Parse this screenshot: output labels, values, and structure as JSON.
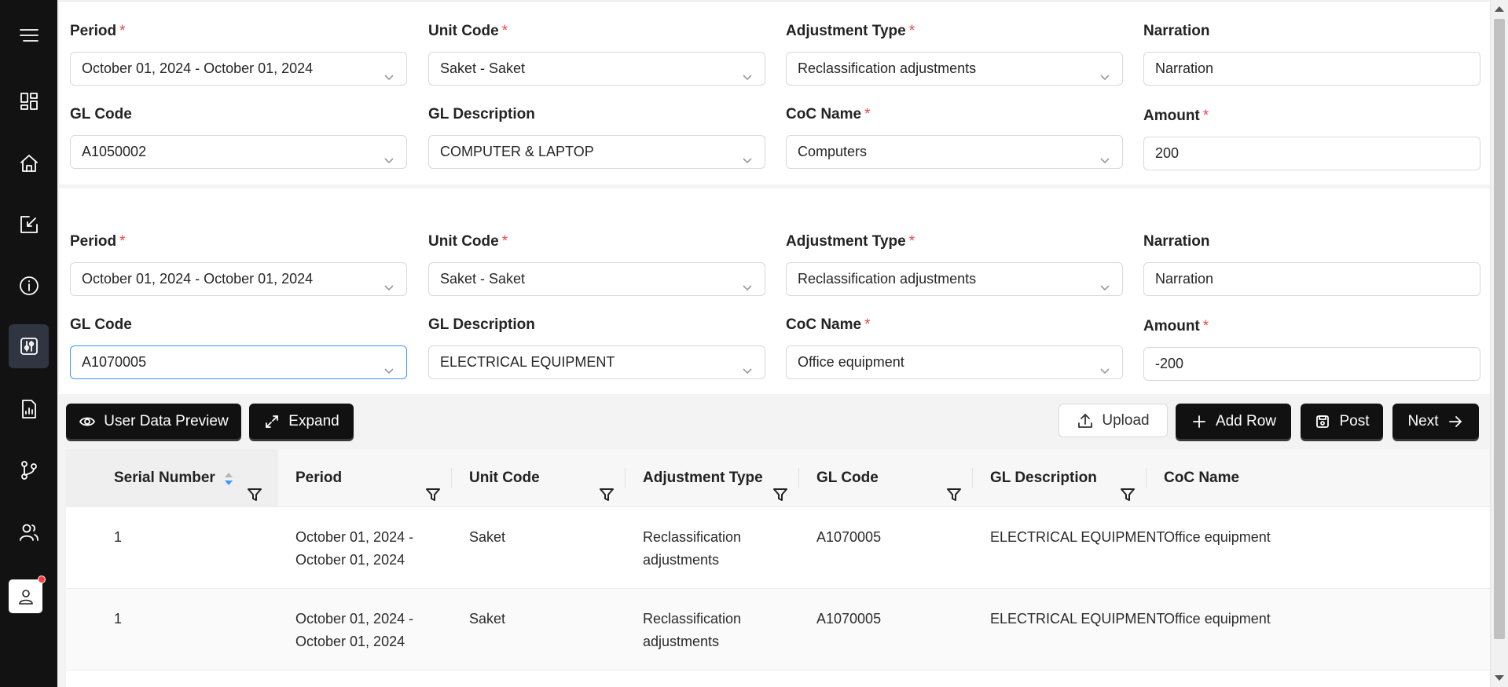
{
  "sidebar": {
    "items": [
      {
        "icon": "menu-icon"
      },
      {
        "icon": "dashboard-icon"
      },
      {
        "icon": "home-icon"
      },
      {
        "icon": "edit-square-icon"
      },
      {
        "icon": "info-icon"
      },
      {
        "icon": "adjustments-icon",
        "active": true
      },
      {
        "icon": "report-icon"
      },
      {
        "icon": "branch-icon"
      },
      {
        "icon": "users-icon"
      }
    ],
    "user_icon": "user-icon"
  },
  "entry1": {
    "period": {
      "label": "Period",
      "required": "*",
      "value": "October 01, 2024 - October 01, 2024"
    },
    "unit_code": {
      "label": "Unit Code",
      "required": "*",
      "value": "Saket - Saket"
    },
    "adjustment_type": {
      "label": "Adjustment Type",
      "required": "*",
      "value": "Reclassification adjustments"
    },
    "narration": {
      "label": "Narration",
      "value": "Narration"
    },
    "gl_code": {
      "label": "GL Code",
      "value": "A1050002"
    },
    "gl_description": {
      "label": "GL Description",
      "value": "COMPUTER & LAPTOP"
    },
    "coc_name": {
      "label": "CoC Name",
      "required": "*",
      "value": "Computers"
    },
    "amount": {
      "label": "Amount",
      "required": "*",
      "value": "200"
    }
  },
  "entry2": {
    "period": {
      "label": "Period",
      "required": "*",
      "value": "October 01, 2024 - October 01, 2024"
    },
    "unit_code": {
      "label": "Unit Code",
      "required": "*",
      "value": "Saket - Saket"
    },
    "adjustment_type": {
      "label": "Adjustment Type",
      "required": "*",
      "value": "Reclassification adjustments"
    },
    "narration": {
      "label": "Narration",
      "value": "Narration"
    },
    "gl_code": {
      "label": "GL Code",
      "value": "A1070005"
    },
    "gl_description": {
      "label": "GL Description",
      "value": "ELECTRICAL EQUIPMENT"
    },
    "coc_name": {
      "label": "CoC Name",
      "required": "*",
      "value": "Office equipment"
    },
    "amount": {
      "label": "Amount",
      "required": "*",
      "value": "-200"
    }
  },
  "toolbar": {
    "user_data_preview": "User Data Preview",
    "expand": "Expand",
    "upload": "Upload",
    "add_row": "Add Row",
    "post": "Post",
    "next": "Next"
  },
  "table": {
    "columns": [
      "Serial Number",
      "Period",
      "Unit Code",
      "Adjustment Type",
      "GL Code",
      "GL Description",
      "CoC Name"
    ],
    "rows": [
      {
        "serial": "1",
        "period_line1": "October 01, 2024 -",
        "period_line2": "October 01, 2024",
        "unit_code": "Saket",
        "adj_line1": "Reclassification",
        "adj_line2": "adjustments",
        "gl_code": "A1070005",
        "gl_description": "ELECTRICAL EQUIPMENT",
        "coc_name": "Office equipment"
      },
      {
        "serial": "1",
        "period_line1": "October 01, 2024 -",
        "period_line2": "October 01, 2024",
        "unit_code": "Saket",
        "adj_line1": "Reclassification",
        "adj_line2": "adjustments",
        "gl_code": "A1070005",
        "gl_description": "ELECTRICAL EQUIPMENT",
        "coc_name": "Office equipment"
      }
    ]
  },
  "colors": {
    "sidebar_bg": "#121212",
    "primary_button": "#111111",
    "required": "#e5484d",
    "focus": "#4096ff",
    "sort_active": "#4096ff"
  }
}
